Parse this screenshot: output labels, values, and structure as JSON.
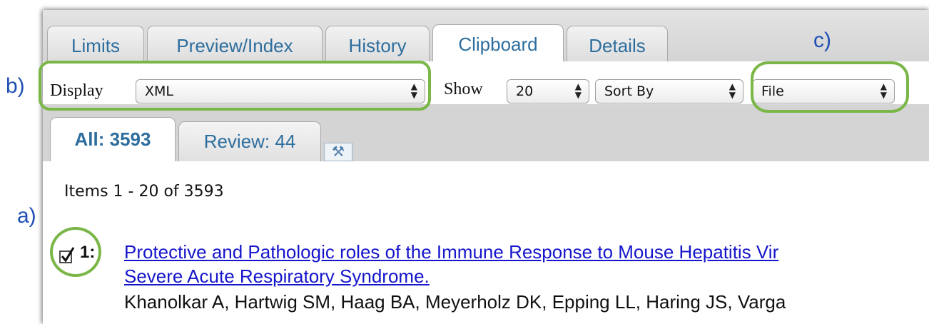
{
  "tabs": [
    "Limits",
    "Preview/Index",
    "History",
    "Clipboard",
    "Details"
  ],
  "toolbar": {
    "display_label": "Display",
    "display_value": "XML",
    "show_label": "Show",
    "show_value": "20",
    "sort_value": "Sort By",
    "sort_field_value": "File"
  },
  "subtabs": {
    "all": "All: 3593",
    "review": "Review: 44",
    "tool_icon": "wrench-hammer-icon"
  },
  "results": {
    "range": "Items 1 - 20 of 3593",
    "item": {
      "number": "1:",
      "checked": true,
      "title_line1": "Protective and Pathologic roles of the Immune Response to Mouse Hepatitis Vir",
      "title_line2": "Severe Acute Respiratory Syndrome.",
      "authors": "Khanolkar A, Hartwig SM, Haag BA, Meyerholz DK, Epping LL, Haring JS, Varga"
    }
  },
  "annotations": {
    "a": "a)",
    "b": "b)",
    "c": "c)"
  },
  "colors": {
    "link": "#1515cc",
    "tab_text": "#2d6e9e",
    "highlight_ring": "#7ab648",
    "annotation": "#1f4fb4"
  }
}
